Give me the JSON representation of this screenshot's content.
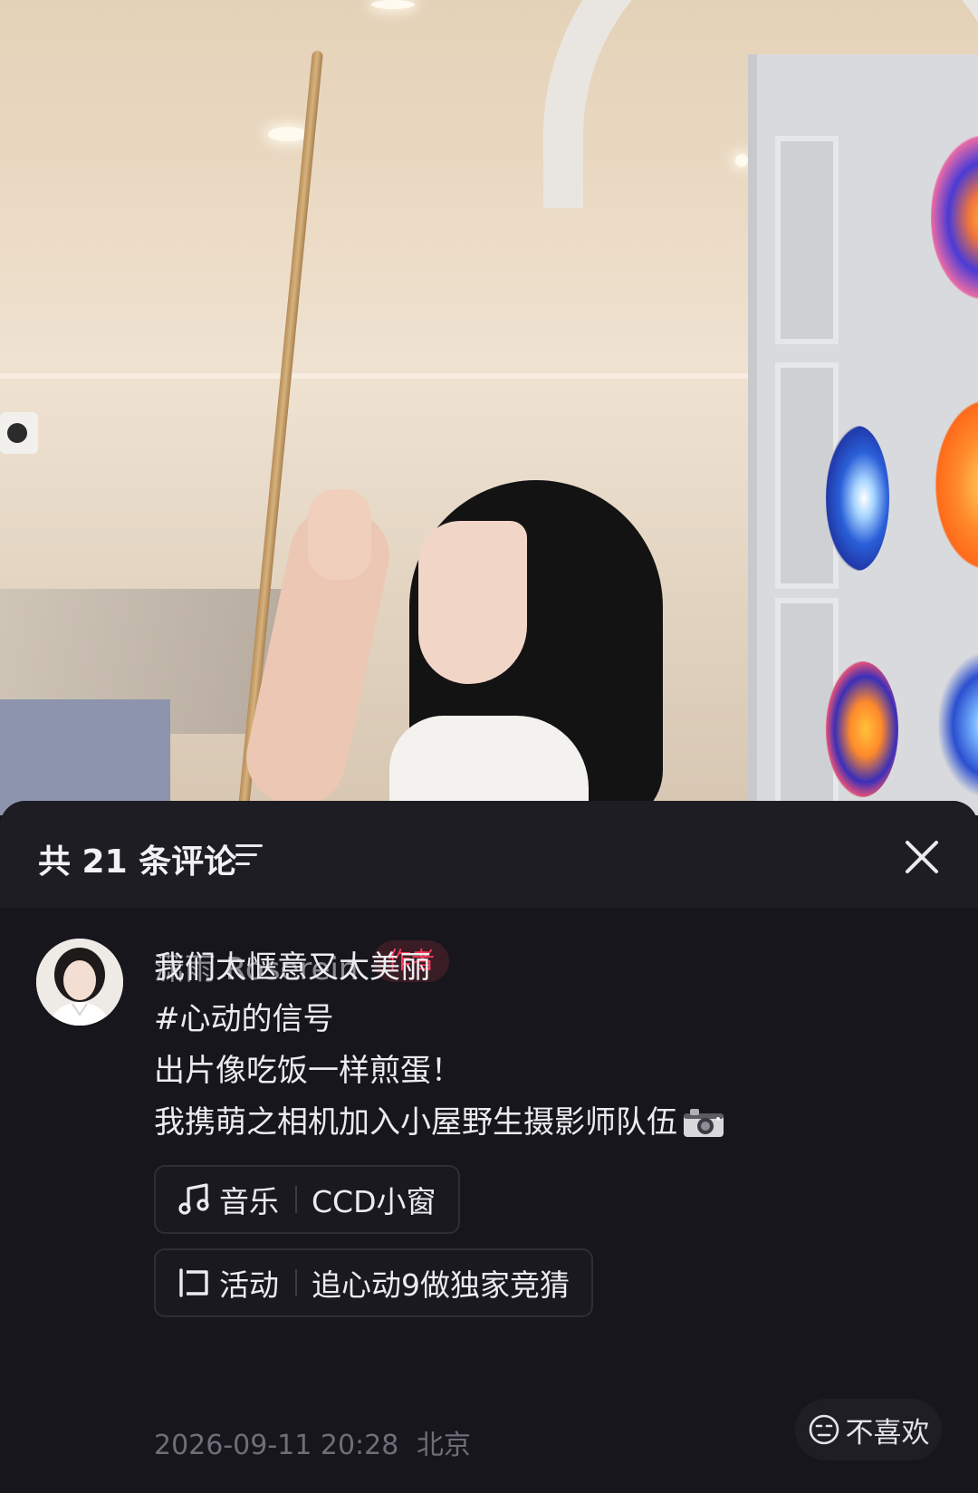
{
  "comments_panel": {
    "title": "共 21 条评论",
    "filter_icon": "filter-lines-icon",
    "close_icon": "close-icon"
  },
  "post": {
    "author": {
      "name": "潇雨 Roserein",
      "badge": "作者"
    },
    "lines": [
      "我们太惬意又太美丽",
      "#心动的信号",
      "出片像吃饭一样煎蛋！",
      "我携萌之相机加入小屋野生摄影师队伍"
    ],
    "trailing_emoji": "camera-emoji",
    "music_chip": {
      "icon": "music-note-icon",
      "label": "音乐",
      "value": "CCD小窗"
    },
    "activity_chip": {
      "icon": "activity-icon",
      "label": "活动",
      "value": "追心动9做独家竞猜"
    },
    "timestamp": "2026-09-11 20:28",
    "location": "北京",
    "dislike": {
      "icon": "unamused-face-icon",
      "label": "不喜欢"
    }
  },
  "colors": {
    "sheet_bg": "#17161c",
    "header_bg": "#1e1d24",
    "badge_text": "#ff3b5c",
    "muted_text": "#8a8a93"
  }
}
